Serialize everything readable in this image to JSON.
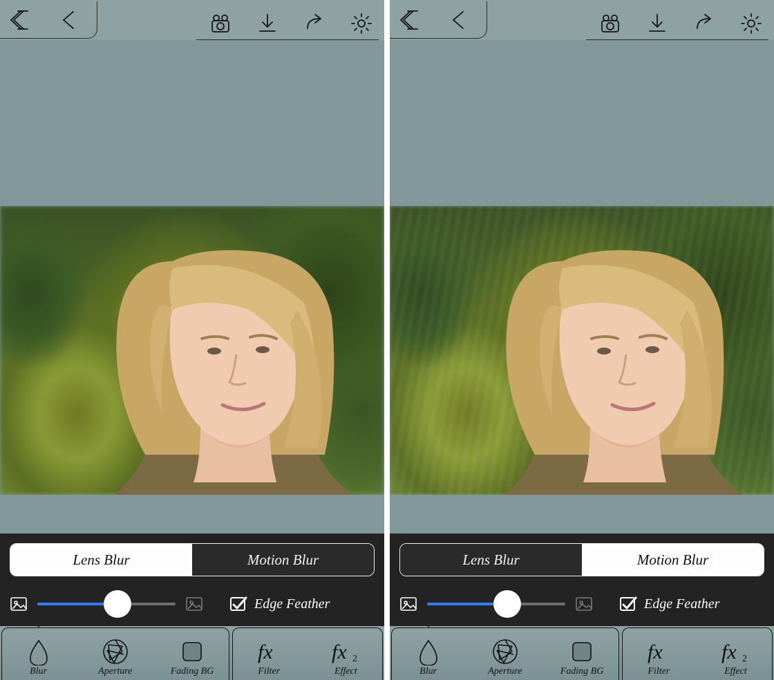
{
  "panes": [
    {
      "id": "left",
      "active_blur_mode": 0,
      "blur_style": "lens",
      "slider_percent": 58,
      "edge_feather_checked": true,
      "active_tab": 0
    },
    {
      "id": "right",
      "active_blur_mode": 1,
      "blur_style": "motion",
      "slider_percent": 58,
      "edge_feather_checked": true,
      "active_tab": 0
    }
  ],
  "toolbar": {
    "icons": [
      "home",
      "back",
      "record",
      "download",
      "share",
      "settings"
    ]
  },
  "blur_modes": [
    "Lens Blur",
    "Motion Blur"
  ],
  "edge_feather_label": "Edge Feather",
  "tabs": [
    {
      "label": "Blur",
      "icon": "drop"
    },
    {
      "label": "Aperture",
      "icon": "aperture"
    },
    {
      "label": "Fading BG",
      "icon": "square"
    },
    {
      "label": "Filter",
      "icon": "fx"
    },
    {
      "label": "Effect",
      "icon": "fx2"
    }
  ],
  "colors": {
    "accent": "#2e7ef6",
    "panel_bg": "#232323",
    "canvas_bg": "#81989a"
  }
}
